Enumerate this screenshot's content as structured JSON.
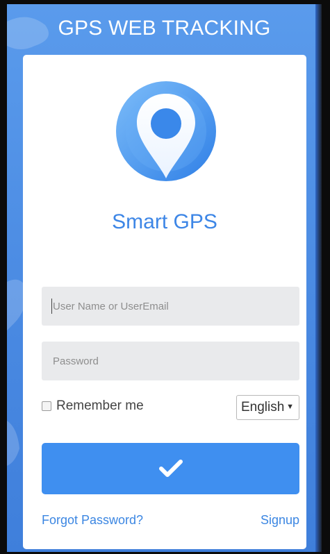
{
  "header": {
    "title": "GPS WEB TRACKING"
  },
  "brand": {
    "name": "Smart GPS",
    "logo_icon": "map-pin-icon"
  },
  "form": {
    "username": {
      "placeholder": "User Name or UserEmail",
      "value": ""
    },
    "password": {
      "placeholder": "Password",
      "value": ""
    },
    "remember_label": "Remember me",
    "remember_checked": false,
    "language": {
      "selected": "English"
    },
    "submit_icon": "checkmark-icon"
  },
  "links": {
    "forgot": "Forgot Password?",
    "signup": "Signup"
  },
  "colors": {
    "background": "#4a8ae2",
    "accent": "#3f8ff0",
    "brand_text": "#3d86e6",
    "input_bg": "#e9eaec"
  }
}
